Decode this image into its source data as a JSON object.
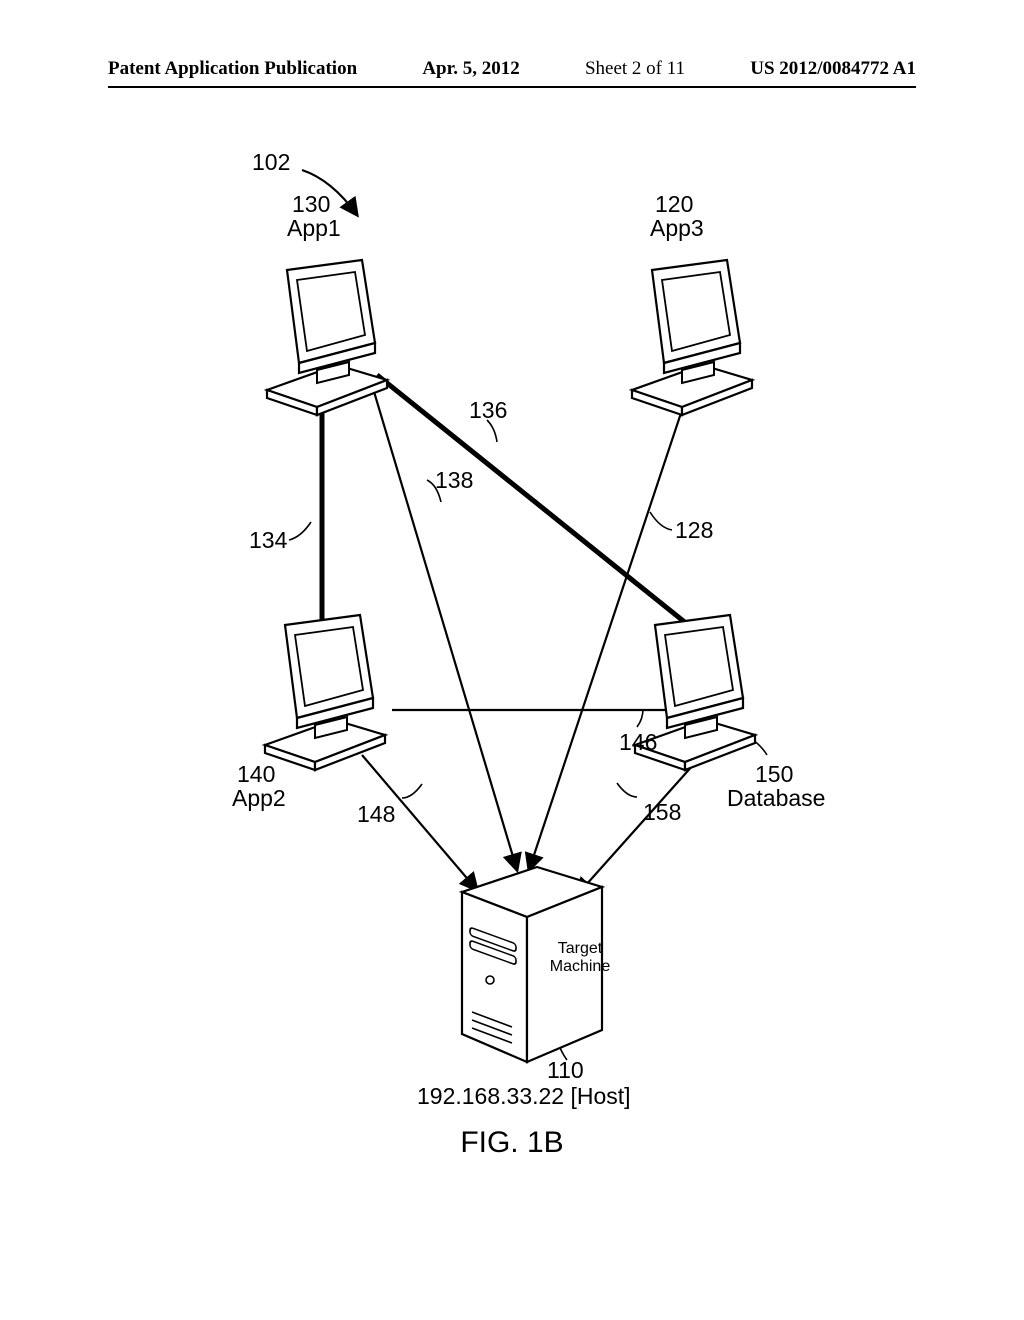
{
  "header": {
    "publication": "Patent Application Publication",
    "date": "Apr. 5, 2012",
    "sheet": "Sheet 2 of 11",
    "doc_number": "US 2012/0084772 A1"
  },
  "figure": {
    "caption": "FIG. 1B",
    "ref_parent": "102"
  },
  "nodes": {
    "app1": {
      "ref": "130",
      "label": "App1"
    },
    "app3": {
      "ref": "120",
      "label": "App3"
    },
    "app2": {
      "ref": "140",
      "label": "App2"
    },
    "database": {
      "ref": "150",
      "label": "Database"
    },
    "target": {
      "ref": "110",
      "label": "Target\nMachine",
      "host": "192.168.33.22 [Host]"
    }
  },
  "edges": {
    "e134": "134",
    "e136": "136",
    "e138": "138",
    "e128": "128",
    "e146": "146",
    "e148": "148",
    "e158": "158"
  }
}
